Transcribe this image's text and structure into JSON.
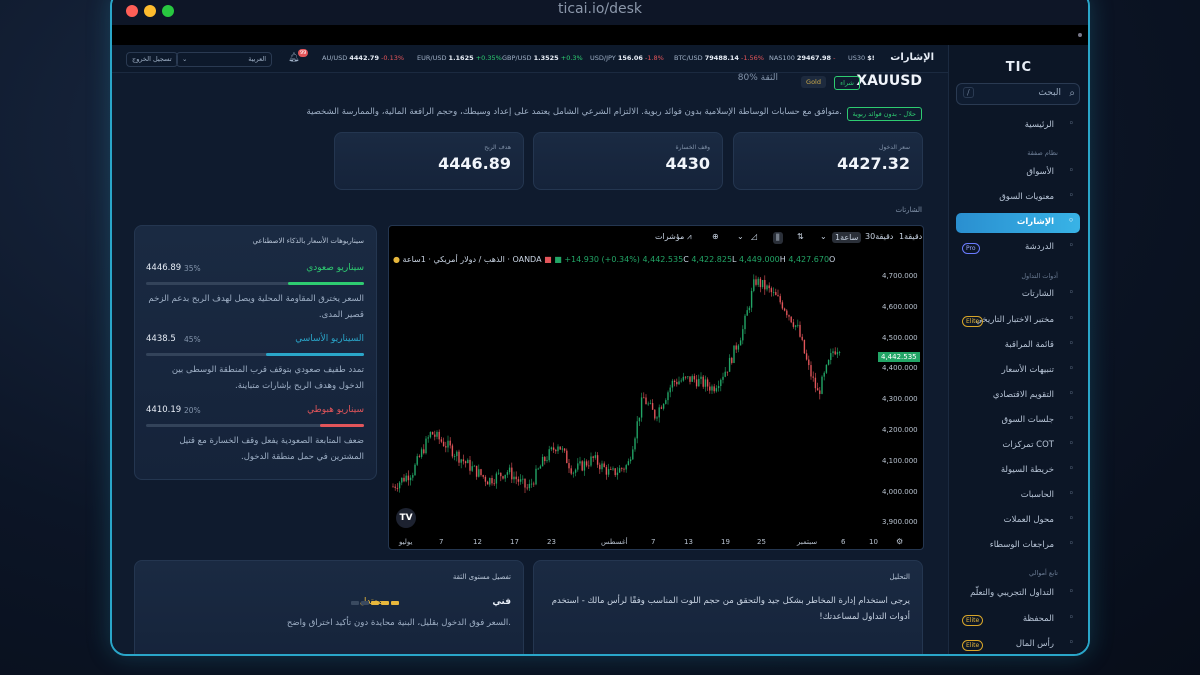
{
  "window": {
    "url": "ticai.io/desk"
  },
  "sidebar": {
    "logo": "TIC",
    "search_label": "البحث",
    "search_shortcut": "/",
    "items": [
      {
        "label": "الرئيسية",
        "icon": "home-icon"
      },
      {
        "label": "الأسواق",
        "icon": "chart-line-icon"
      },
      {
        "label": "معنويات السوق",
        "icon": "gauge-icon"
      },
      {
        "label": "الإشارات",
        "icon": "signal-icon"
      },
      {
        "label": "الدردشة",
        "icon": "sparkle-icon",
        "badge": "Pro"
      },
      {
        "label": "الشارتات",
        "icon": "candles-icon"
      },
      {
        "label": "مختبر الاختبار التاريخي",
        "icon": "history-icon",
        "badge": "Elite"
      },
      {
        "label": "قائمة المراقبة",
        "icon": "eye-icon"
      },
      {
        "label": "تنبيهات الأسعار",
        "icon": "bell-icon"
      },
      {
        "label": "التقويم الاقتصادي",
        "icon": "calendar-icon"
      },
      {
        "label": "جلسات السوق",
        "icon": "clock-icon"
      },
      {
        "label": "تمركزات COT",
        "icon": "bars-icon"
      },
      {
        "label": "خريطة السيولة",
        "icon": "map-icon"
      },
      {
        "label": "الحاسبات",
        "icon": "calculator-icon"
      },
      {
        "label": "محول العملات",
        "icon": "swap-icon"
      },
      {
        "label": "مراجعات الوسطاء",
        "icon": "shield-icon"
      },
      {
        "label": "التداول التجريبي والتعلّم",
        "icon": "users-icon"
      },
      {
        "label": "المحفظة",
        "icon": "wallet-icon",
        "badge": "Elite"
      },
      {
        "label": "رأس المال",
        "icon": "money-icon",
        "badge": "Elite"
      }
    ],
    "sections": [
      "نظام صفقة",
      "أدوات التداول",
      "تابع أموالي"
    ]
  },
  "header": {
    "title": "الإشارات",
    "tickers": [
      {
        "sym": "US30",
        "price": "$!",
        "change": ""
      },
      {
        "sym": "NAS100",
        "price": "29467.98",
        "change": "-",
        "dir": "down"
      },
      {
        "sym": "BTC/USD",
        "price": "79488.14",
        "change": "-1.56%",
        "dir": "down"
      },
      {
        "sym": "USD/JPY",
        "price": "156.06",
        "change": "-1.8%",
        "dir": "down"
      },
      {
        "sym": "GBP/USD",
        "price": "1.3525",
        "change": "+0.3%",
        "dir": "up"
      },
      {
        "sym": "EUR/USD",
        "price": "1.1625",
        "change": "+0.35%",
        "dir": "up"
      },
      {
        "sym": "AU/USD",
        "price": "4442.79",
        "change": "-0.13%",
        "dir": "down"
      }
    ],
    "notifications": "99",
    "language": "العربية",
    "logout": "تسجيل الخروج"
  },
  "signal": {
    "symbol": "XAUUSD",
    "action_tag": "شراء",
    "category_tag": "Gold",
    "confidence": "80% الثقة",
    "halal_tag": "حلال - بدون فوائد ربوية",
    "description": "متوافق مع حسابات الوساطة الإسلامية بدون فوائد ربوية. الالتزام الشرعي الشامل يعتمد على إعداد وسيطك، وحجم الرافعة المالية، والممارسة الشخصية.",
    "stats": [
      {
        "label": "سعر الدخول",
        "value": "4427.32"
      },
      {
        "label": "وقف الخسارة",
        "value": "4430"
      },
      {
        "label": "هدف الربح",
        "value": "4446.89"
      }
    ],
    "charts_label": "الشارتات"
  },
  "chart": {
    "intervals": [
      "1دقيقة",
      "30دقيقة",
      "1ساعة"
    ],
    "indicators": "مؤشرات",
    "title": "الذهب / دولار أمريكي · 1ساعة · OANDA",
    "ohlc": {
      "o": "4,427.670",
      "h": "4,449.000",
      "l": "4,422.825",
      "c": "4,442.535",
      "chg": "+14.930 (+0.34%)"
    },
    "last_price": "4,442.535",
    "y_ticks": [
      "4,700.000",
      "4,600.000",
      "4,500.000",
      "4,400.000",
      "4,300.000",
      "4,200.000",
      "4,100.000",
      "4,000.000",
      "3,900.000"
    ],
    "x_ticks": [
      "يوليو",
      "7",
      "12",
      "17",
      "23",
      "أغسطس",
      "7",
      "13",
      "19",
      "25",
      "سبتمبر",
      "6",
      "10"
    ],
    "accent_up": "#22a566",
    "accent_down": "#e2555a"
  },
  "scenarios": {
    "title": "سيناريوهات الأسعار بالذكاء الاصطناعي",
    "items": [
      {
        "name": "سيناريو صعودي",
        "price": "4446.89",
        "pct": "35%",
        "prob": 35,
        "color": "#2ecc71",
        "text": "السعر يخترق المقاومة المحلية ويصل لهدف الربح بدعم الزخم قصير المدى."
      },
      {
        "name": "السيناريو الأساسي",
        "price": "4438.5",
        "pct": "45%",
        "prob": 45,
        "color": "#2aa6c9",
        "text": "تمدد طفيف صعودي بتوقف قرب المنطقة الوسطى بين الدخول وهدف الربح بإشارات متباينة."
      },
      {
        "name": "سيناريو هبوطي",
        "price": "4410.19",
        "pct": "20%",
        "prob": 20,
        "color": "#e2555a",
        "text": "ضعف المتابعة الصعودية يفعل وقف الخسارة مع قتيل المشترين في حمل منطقة الدخول."
      }
    ]
  },
  "analysis": {
    "title": "التحليل",
    "body": "يرجى استخدام إدارة المخاطر بشكل جيد والتحقق من حجم اللوت المناسب وفقًا لرأس مالك - استخدم أدوات التداول لمساعدتك!"
  },
  "confidence_detail": {
    "title": "تفصيل مستوى الثقة",
    "label": "فني",
    "level": "معتدل",
    "level_fraction": 0.6,
    "desc": "السعر فوق الدخول بقليل، البنية محايدة دون تأكيد اختراق واضح."
  }
}
